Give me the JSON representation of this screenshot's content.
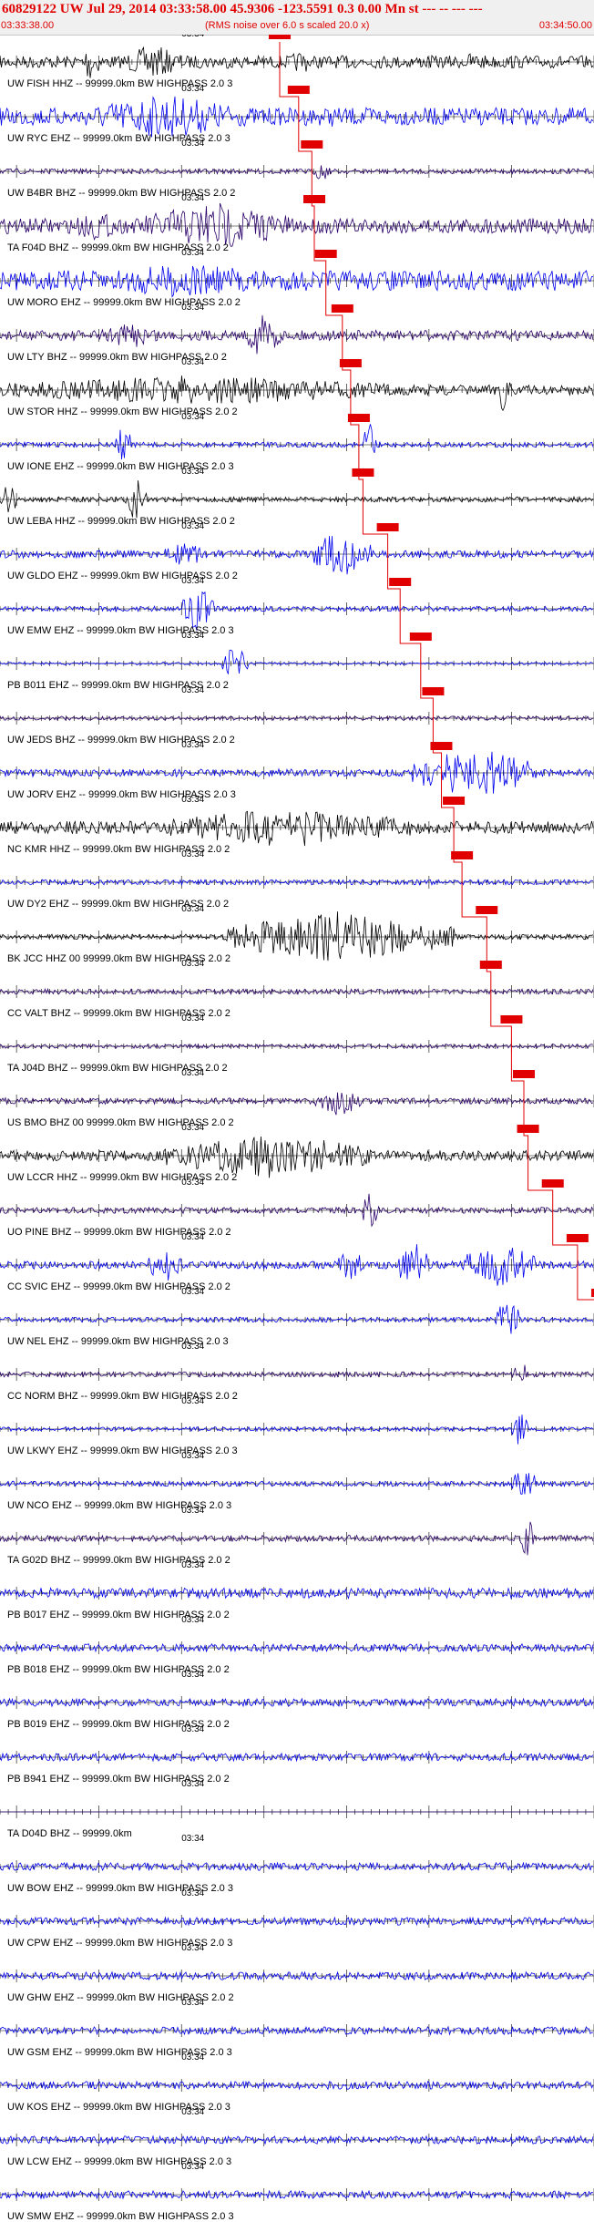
{
  "header": {
    "title": "60829122 UW Jul 29, 2014 03:33:58.00   45.9306 -123.5591  0.3 0.00 Mn st --- -- ---  ---",
    "start_time": "03:33:38.00",
    "rms_note": "(RMS noise over 6.0 s scaled 20.0 x)",
    "end_time": "03:34:50.00"
  },
  "colors": {
    "title": "#e00000",
    "pick": "#e00000",
    "black": "#000000",
    "blue": "#0000ee",
    "purple": "#2a006a"
  },
  "chart_data": {
    "type": "seismogram",
    "minute_label": "03:34",
    "traces": [
      {
        "label": "UW FISH HHZ -- 99999.0km BW  HIGHPASS  2.0  3",
        "color": "black",
        "amp": 0.25,
        "bursts": [
          [
            10,
            12,
            0.9
          ],
          [
            15,
            22,
            0.7
          ],
          [
            35,
            38,
            0.5
          ],
          [
            55,
            60,
            0.4
          ]
        ],
        "pick": 33.9
      },
      {
        "label": "UW RYC EHZ -- 99999.0km BW  HIGHPASS  2.0  3",
        "color": "blue",
        "amp": 0.35,
        "bursts": [
          [
            10,
            30,
            0.9
          ],
          [
            35,
            45,
            0.4
          ]
        ],
        "pick": 36.2
      },
      {
        "label": "UW B4BR BHZ -- 99999.0km BW  HIGHPASS  2.0  2",
        "color": "purple",
        "amp": 0.1,
        "bursts": [
          [
            38,
            40,
            0.4
          ]
        ],
        "pick": 37.8
      },
      {
        "label": "TA F04D BHZ -- 99999.0km BW  HIGHPASS  2.0  2",
        "color": "purple",
        "amp": 0.3,
        "bursts": [
          [
            8,
            15,
            0.6
          ],
          [
            17,
            35,
            1.0
          ]
        ],
        "pick": 38.1
      },
      {
        "label": "UW MORO EHZ -- 99999.0km BW  HIGHPASS  2.0  2",
        "color": "blue",
        "amp": 0.4,
        "bursts": [
          [
            10,
            35,
            0.7
          ]
        ],
        "pick": 39.5
      },
      {
        "label": "UW LTY BHZ -- 99999.0km BW  HIGHPASS  2.0  2",
        "color": "purple",
        "amp": 0.2,
        "bursts": [
          [
            12,
            20,
            0.5
          ],
          [
            30,
            34,
            1.0
          ]
        ],
        "pick": 41.5
      },
      {
        "label": "UW STOR HHZ -- 99999.0km BW  HIGHPASS  2.0  2",
        "color": "black",
        "amp": 0.2,
        "bursts": [
          [
            0,
            48,
            0.6
          ],
          [
            60,
            62,
            1.0
          ]
        ],
        "pick": 42.5
      },
      {
        "label": "UW IONE EHZ -- 99999.0km BW  HIGHPASS  2.0  3",
        "color": "blue",
        "amp": 0.1,
        "bursts": [
          [
            14,
            16,
            0.8
          ],
          [
            44,
            46,
            1.0
          ]
        ],
        "pick": 43.5
      },
      {
        "label": "UW LEBA HHZ -- 99999.0km BW  HIGHPASS  2.0  2",
        "color": "black",
        "amp": 0.1,
        "bursts": [
          [
            0,
            2,
            0.7
          ],
          [
            15,
            18,
            0.9
          ]
        ],
        "pick": 44.0
      },
      {
        "label": "UW GLDO EHZ -- 99999.0km BW  HIGHPASS  2.0  2",
        "color": "blue",
        "amp": 0.15,
        "bursts": [
          [
            20,
            25,
            0.5
          ],
          [
            38,
            45,
            1.0
          ]
        ],
        "pick": 47.0
      },
      {
        "label": "UW EMW EHZ -- 99999.0km BW  HIGHPASS  2.0  3",
        "color": "blue",
        "amp": 0.1,
        "bursts": [
          [
            22,
            26,
            0.9
          ]
        ],
        "pick": 48.5
      },
      {
        "label": "PB B011 EHZ -- 99999.0km BW  HIGHPASS  2.0  2",
        "color": "blue",
        "amp": 0.05,
        "bursts": [
          [
            27,
            30,
            0.7
          ]
        ],
        "pick": 51.0
      },
      {
        "label": "UW JEDS BHZ -- 99999.0km BW  HIGHPASS  2.0  2",
        "color": "purple",
        "amp": 0.08,
        "bursts": [],
        "pick": 52.5
      },
      {
        "label": "UW JORV EHZ -- 99999.0km BW  HIGHPASS  2.0  3",
        "color": "blue",
        "amp": 0.15,
        "bursts": [
          [
            50,
            65,
            1.0
          ]
        ],
        "pick": 53.5
      },
      {
        "label": "NC KMR HHZ -- 99999.0km BW  HIGHPASS  2.0  2",
        "color": "black",
        "amp": 0.25,
        "bursts": [
          [
            20,
            50,
            0.8
          ]
        ],
        "pick": 55.0
      },
      {
        "label": "UW DY2 EHZ -- 99999.0km BW  HIGHPASS  2.0  2",
        "color": "blue",
        "amp": 0.1,
        "bursts": [],
        "pick": 56.0
      },
      {
        "label": "BK JCC HHZ 00 99999.0km BW  HIGHPASS  2.0  2",
        "color": "black",
        "amp": 0.1,
        "bursts": [
          [
            27,
            55,
            1.0
          ]
        ],
        "pick": 59.0
      },
      {
        "label": "CC VALT BHZ -- 99999.0km BW  HIGHPASS  2.0  2",
        "color": "purple",
        "amp": 0.1,
        "bursts": [],
        "pick": 59.5
      },
      {
        "label": "TA J04D BHZ -- 99999.0km BW  HIGHPASS  2.0  2",
        "color": "purple",
        "amp": 0.08,
        "bursts": [],
        "pick": 62.0
      },
      {
        "label": "US BMO BHZ 00 99999.0km BW  HIGHPASS  2.0  2",
        "color": "purple",
        "amp": 0.12,
        "bursts": [
          [
            38,
            44,
            0.6
          ]
        ],
        "pick": 63.5
      },
      {
        "label": "UW LCCR HHZ -- 99999.0km BW  HIGHPASS  2.0  2",
        "color": "black",
        "amp": 0.2,
        "bursts": [
          [
            20,
            45,
            0.9
          ]
        ],
        "pick": 64.0
      },
      {
        "label": "UO PINE BHZ -- 99999.0km BW  HIGHPASS  2.0  2",
        "color": "purple",
        "amp": 0.12,
        "bursts": [
          [
            44,
            46,
            0.9
          ]
        ],
        "pick": 67.0
      },
      {
        "label": "CC SVIC EHZ -- 99999.0km BW  HIGHPASS  2.0  2",
        "color": "blue",
        "amp": 0.15,
        "bursts": [
          [
            18,
            22,
            0.7
          ],
          [
            41,
            44,
            0.7
          ],
          [
            48,
            52,
            1.0
          ],
          [
            56,
            65,
            0.9
          ]
        ],
        "pick": 70.0
      },
      {
        "label": "UW NEL EHZ -- 99999.0km BW  HIGHPASS  2.0  3",
        "color": "blue",
        "amp": 0.1,
        "bursts": [
          [
            60,
            63,
            0.9
          ]
        ],
        "pick": 73.0
      },
      {
        "label": "CC NORM BHZ -- 99999.0km BW  HIGHPASS  2.0  2",
        "color": "purple",
        "amp": 0.1,
        "bursts": [
          [
            62,
            64,
            0.6
          ]
        ],
        "pick": 74.5
      },
      {
        "label": "UW LKWY EHZ -- 99999.0km BW  HIGHPASS  2.0  3",
        "color": "blue",
        "amp": 0.08,
        "bursts": [
          [
            62,
            64,
            0.7
          ]
        ],
        "pick": 75.0
      },
      {
        "label": "UW NCO EHZ -- 99999.0km BW  HIGHPASS  2.0  3",
        "color": "blue",
        "amp": 0.1,
        "bursts": [
          [
            62,
            65,
            0.7
          ]
        ],
        "pick": 75.5
      },
      {
        "label": "TA G02D BHZ -- 99999.0km BW  HIGHPASS  2.0  2",
        "color": "purple",
        "amp": 0.12,
        "bursts": [
          [
            63,
            65,
            0.8
          ]
        ],
        "pick": 76.0
      },
      {
        "label": "PB B017 EHZ -- 99999.0km BW  HIGHPASS  2.0  2",
        "color": "blue",
        "amp": 0.2,
        "bursts": [],
        "pick": null
      },
      {
        "label": "PB B018 EHZ -- 99999.0km BW  HIGHPASS  2.0  2",
        "color": "blue",
        "amp": 0.15,
        "bursts": [],
        "pick": null
      },
      {
        "label": "PB B019 EHZ -- 99999.0km BW  HIGHPASS  2.0  2",
        "color": "blue",
        "amp": 0.15,
        "bursts": [],
        "pick": null
      },
      {
        "label": "PB B941 EHZ -- 99999.0km BW  HIGHPASS  2.0  2",
        "color": "blue",
        "amp": 0.15,
        "bursts": [],
        "pick": null
      },
      {
        "label": "TA D04D BHZ -- 99999.0km",
        "color": "purple",
        "amp": 0.0,
        "bursts": [],
        "pick": null
      },
      {
        "label": "UW BOW EHZ -- 99999.0km BW  HIGHPASS  2.0  3",
        "color": "blue",
        "amp": 0.15,
        "bursts": [],
        "pick": null
      },
      {
        "label": "UW CPW EHZ -- 99999.0km BW  HIGHPASS  2.0  3",
        "color": "blue",
        "amp": 0.15,
        "bursts": [],
        "pick": null
      },
      {
        "label": "UW GHW EHZ -- 99999.0km BW  HIGHPASS  2.0  2",
        "color": "blue",
        "amp": 0.15,
        "bursts": [],
        "pick": null
      },
      {
        "label": "UW GSM EHZ -- 99999.0km BW  HIGHPASS  2.0  3",
        "color": "blue",
        "amp": 0.15,
        "bursts": [],
        "pick": null
      },
      {
        "label": "UW KOS EHZ -- 99999.0km BW  HIGHPASS  2.0  3",
        "color": "blue",
        "amp": 0.15,
        "bursts": [],
        "pick": null
      },
      {
        "label": "UW LCW EHZ -- 99999.0km BW  HIGHPASS  2.0  3",
        "color": "blue",
        "amp": 0.15,
        "bursts": [],
        "pick": null
      },
      {
        "label": "UW SMW EHZ -- 99999.0km BW  HIGHPASS  2.0  3",
        "color": "blue",
        "amp": 0.15,
        "bursts": [],
        "pick": null
      }
    ]
  }
}
